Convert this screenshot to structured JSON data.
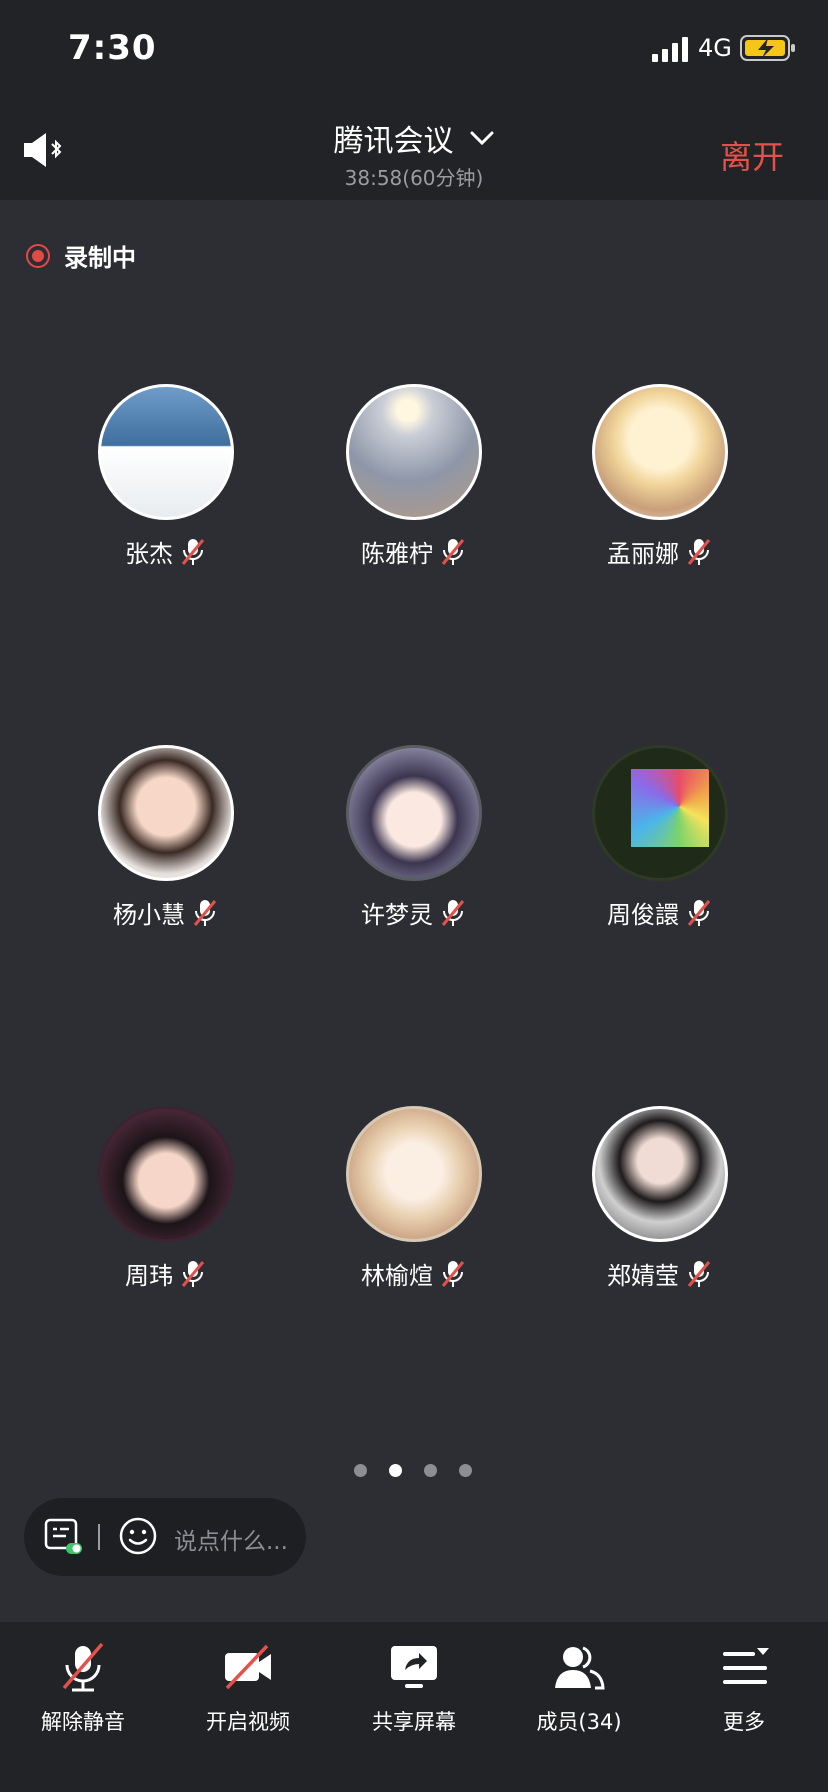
{
  "status_bar": {
    "time": "7:30",
    "network": "4G"
  },
  "header": {
    "title": "腾讯会议",
    "timer": "38:58(60分钟)",
    "leave_label": "离开"
  },
  "recording": {
    "label": "录制中"
  },
  "participants": [
    {
      "name": "张杰",
      "muted": true
    },
    {
      "name": "陈雅柠",
      "muted": true
    },
    {
      "name": "孟丽娜",
      "muted": true
    },
    {
      "name": "杨小慧",
      "muted": true
    },
    {
      "name": "许梦灵",
      "muted": true
    },
    {
      "name": "周俊譞",
      "muted": true
    },
    {
      "name": "周玮",
      "muted": true
    },
    {
      "name": "林榆煊",
      "muted": true
    },
    {
      "name": "郑婧莹",
      "muted": true
    }
  ],
  "pagination": {
    "total": 4,
    "current": 2
  },
  "chat": {
    "placeholder": "说点什么..."
  },
  "toolbar": {
    "unmute": "解除静音",
    "video": "开启视频",
    "share": "共享屏幕",
    "members": "成员(34)",
    "more": "更多"
  },
  "colors": {
    "accent_red": "#e4514a",
    "background": "#2c2e33",
    "bar": "#222326"
  }
}
